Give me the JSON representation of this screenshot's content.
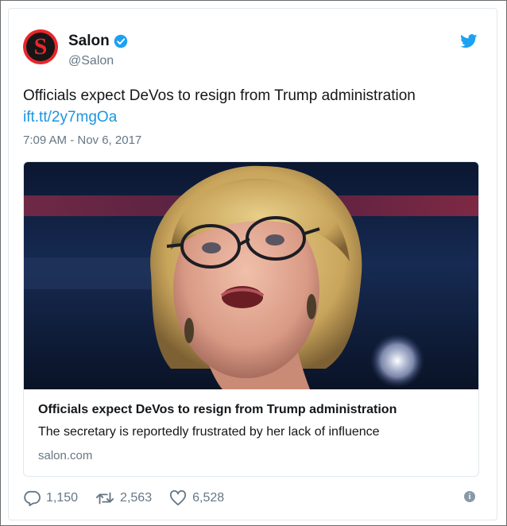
{
  "account": {
    "name": "Salon",
    "handle": "@Salon",
    "avatar_letter": "S",
    "verified": true,
    "brand_color": "#e8262b"
  },
  "tweet": {
    "text": "Officials expect DeVos to resign from Trump administration",
    "link": "ift.tt/2y7mgOa",
    "timestamp": "7:09 AM - Nov 6, 2017"
  },
  "card": {
    "title": "Officials expect DeVos to resign from Trump administration",
    "description": "The secretary is reportedly frustrated by her lack of influence",
    "domain": "salon.com"
  },
  "actions": {
    "replies": "1,150",
    "retweets": "2,563",
    "likes": "6,528"
  },
  "icons": {
    "logo": "twitter-bird-icon",
    "verified": "verified-badge-icon",
    "reply": "reply-icon",
    "retweet": "retweet-icon",
    "like": "heart-icon",
    "info": "info-icon"
  },
  "colors": {
    "link": "#1b95e0",
    "secondary_text": "#657786",
    "twitter_blue": "#1da1f2"
  }
}
